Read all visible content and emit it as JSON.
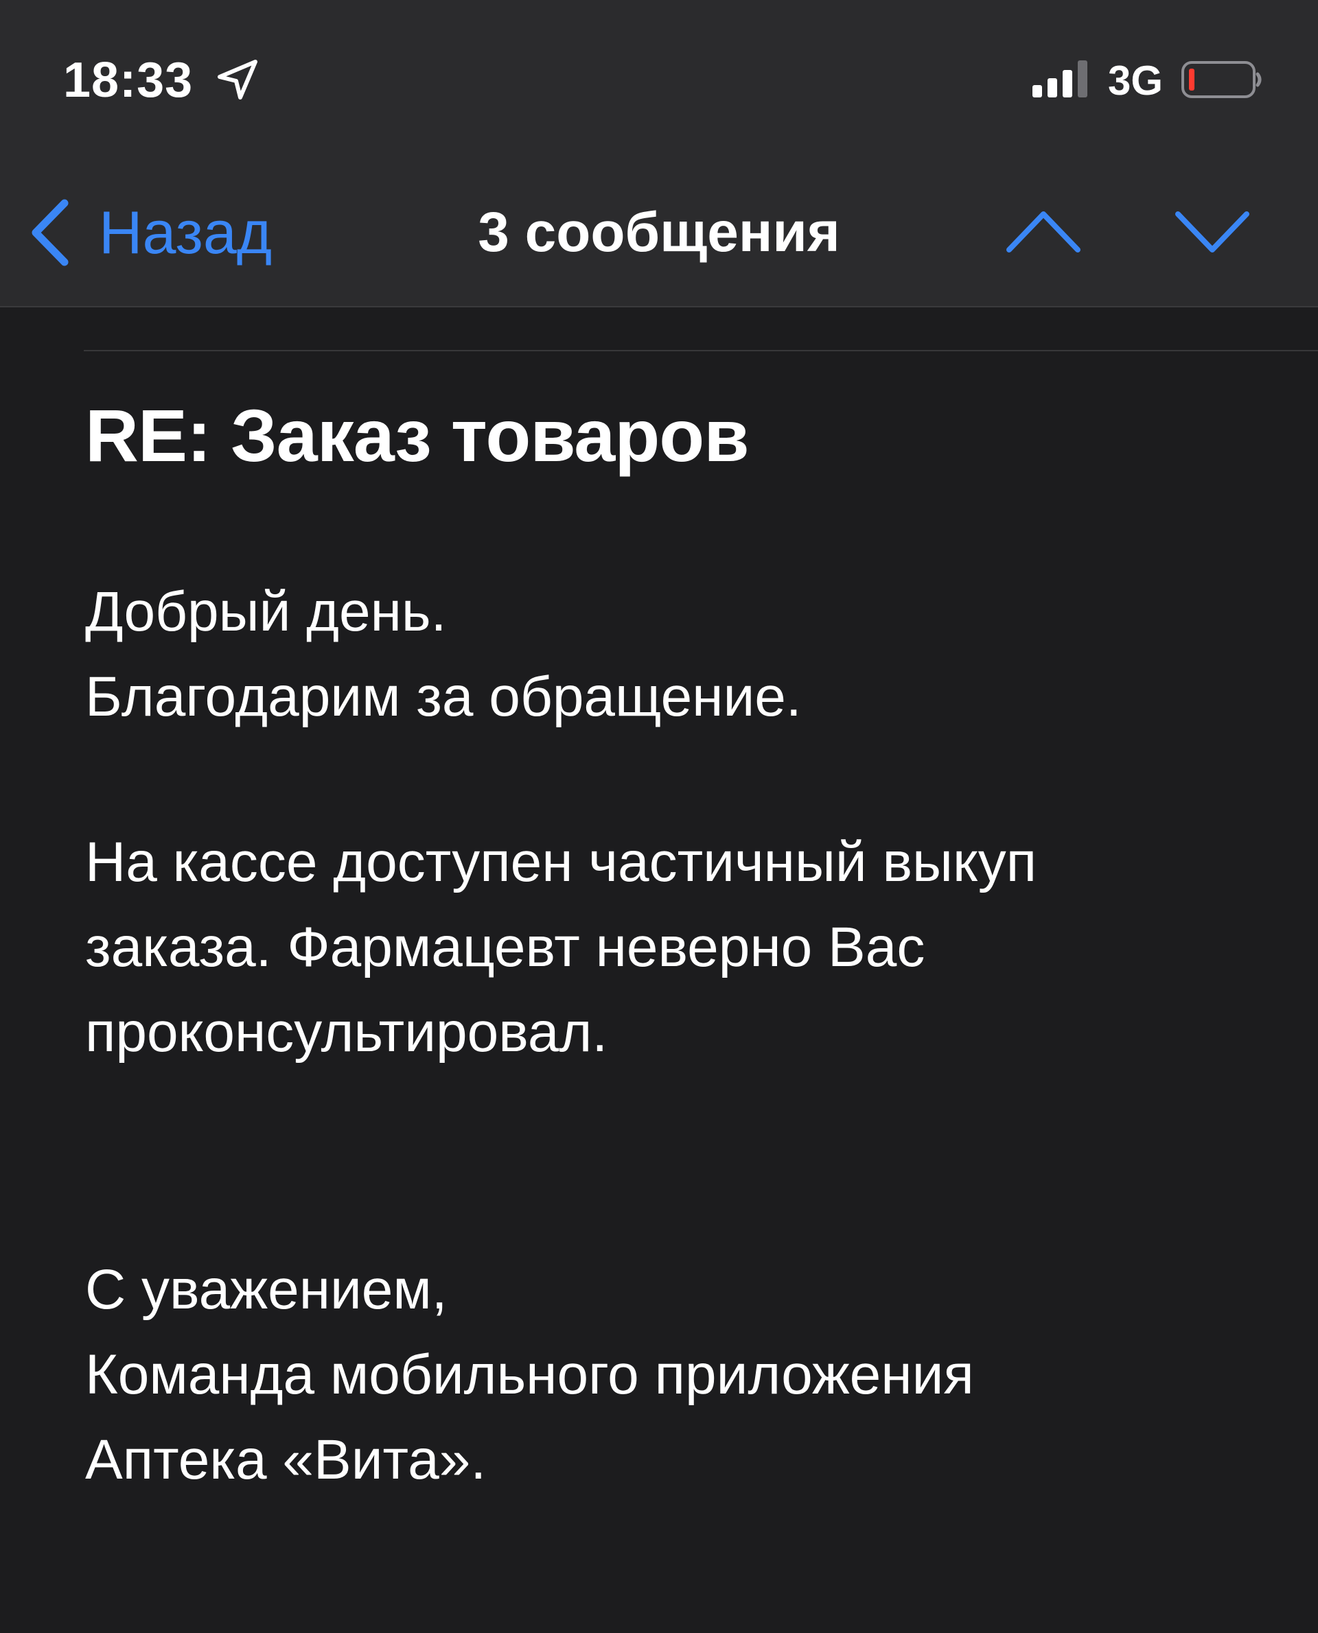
{
  "status_bar": {
    "time": "18:33",
    "network": "3G",
    "battery_color": "#ff3b30"
  },
  "nav": {
    "back_label": "Назад",
    "title": "3 сообщения",
    "accent_color": "#3a86f5"
  },
  "email": {
    "subject": "RE: Заказ товаров",
    "paragraphs": {
      "greeting": [
        "Добрый день.",
        "Благодарим за обращение."
      ],
      "info": [
        "На кассе доступен частичный выкуп",
        "заказа. Фармацевт неверно Вас",
        "проконсультировал."
      ],
      "signature": [
        "С уважением,",
        "Команда мобильного приложения",
        "Аптека «Вита»."
      ]
    }
  }
}
